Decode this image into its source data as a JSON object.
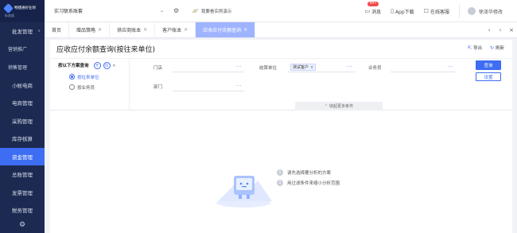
{
  "app": {
    "logo_name": "畅捷通好业财",
    "edition": "标准版"
  },
  "sidebar": {
    "items": [
      {
        "label": "批发管理",
        "active": false,
        "sub": false,
        "caret": "∨"
      },
      {
        "label": "营销推广",
        "active": false,
        "sub": true
      },
      {
        "label": "销售管理",
        "active": false,
        "sub": true
      },
      {
        "label": "小帐电商",
        "active": false,
        "sub": false
      },
      {
        "label": "电商管理",
        "active": false,
        "sub": false
      },
      {
        "label": "采购管理",
        "active": false,
        "sub": false
      },
      {
        "label": "库存核算",
        "active": false,
        "sub": false
      },
      {
        "label": "资金管理",
        "active": true,
        "sub": false
      },
      {
        "label": "总账管理",
        "active": false,
        "sub": false
      },
      {
        "label": "发票管理",
        "active": false,
        "sub": false
      },
      {
        "label": "税务管理",
        "active": false,
        "sub": false
      }
    ]
  },
  "topbar": {
    "account": "实习联系账套",
    "demo_label": "我要看实例演示",
    "messages_label": "消息",
    "messages_badge": "99+",
    "app_download_label": "App下载",
    "online_service_label": "在线客服",
    "user_name": "徐泽华修改"
  },
  "tabs": [
    {
      "label": "首页",
      "closable": false,
      "active": false
    },
    {
      "label": "赠品策略",
      "closable": true,
      "active": false
    },
    {
      "label": "供应商账本",
      "closable": true,
      "active": false
    },
    {
      "label": "客户账本",
      "closable": true,
      "active": false
    },
    {
      "label": "应收应付余额查询",
      "closable": true,
      "active": true
    }
  ],
  "tab_close_glyph": "×",
  "page": {
    "title": "应收应付余额查询(按往来单位)",
    "export_label": "导出",
    "refresh_label": "刷新"
  },
  "scheme": {
    "title": "按以下方案查询",
    "add_glyph": "+",
    "options": [
      {
        "label": "按往来单位",
        "active": true
      },
      {
        "label": "按业务员",
        "active": false
      }
    ]
  },
  "filters": {
    "store_label": "门店",
    "settle_label": "结算单位",
    "settle_tag": "测试客户",
    "salesman_label": "业务员",
    "dept_label": "部门",
    "more_glyph": "···",
    "query_label": "查询",
    "settings_label": "设置",
    "collapse_label": "收起更多条件"
  },
  "empty": {
    "tips": [
      {
        "num": "1",
        "text": "请先选择要分析的方案"
      },
      {
        "num": "2",
        "text": "用过滤条件来缩小分析范围"
      }
    ]
  },
  "colors": {
    "sidebar_bg": "#1c2a52",
    "accent": "#3d6df2",
    "active_tab": "#9fb4ff",
    "badge": "#f24a4a"
  }
}
